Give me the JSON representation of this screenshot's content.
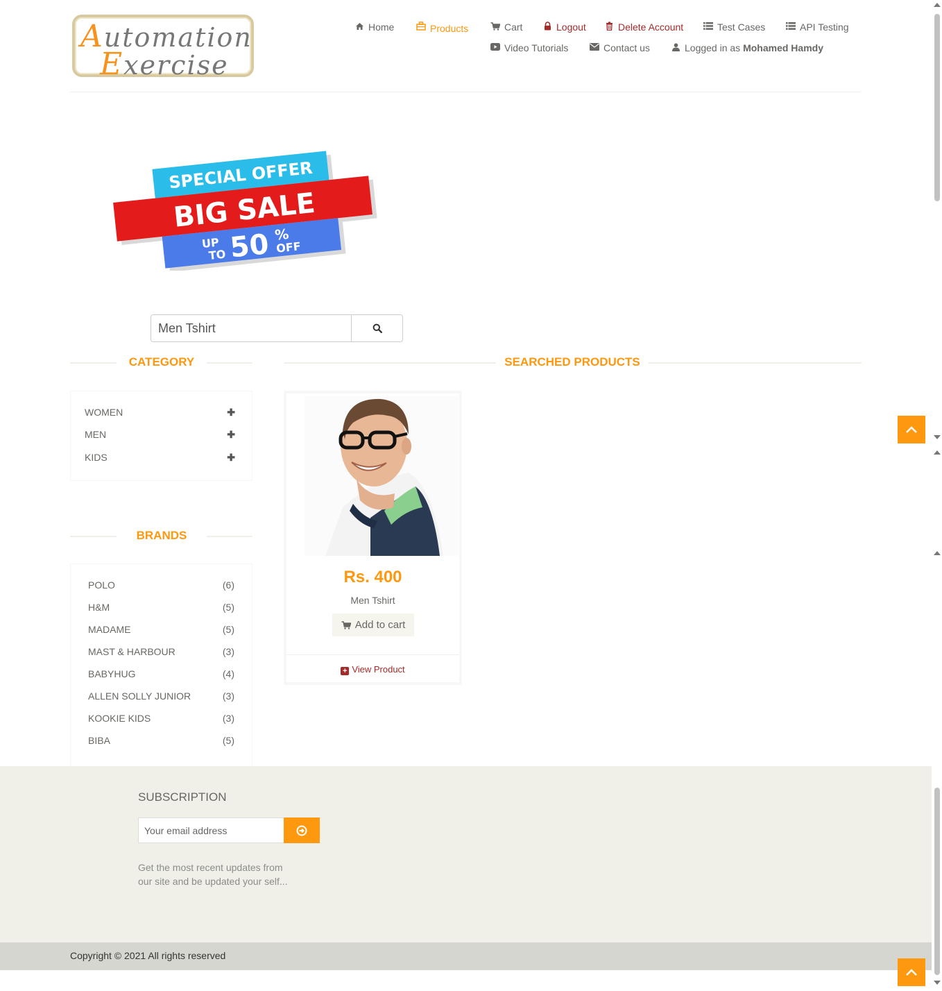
{
  "logo": {
    "line1_cap": "A",
    "line1_rest": "utomation",
    "line2_cap": "E",
    "line2_rest": "xercise"
  },
  "nav": {
    "home": "Home",
    "products": "Products",
    "cart": "Cart",
    "logout": "Logout",
    "delete_account": "Delete Account",
    "test_cases": "Test Cases",
    "api_testing": "API Testing",
    "video_tutorials": "Video Tutorials",
    "contact_us": "Contact us",
    "logged_in_prefix": "Logged in as",
    "logged_in_user": "Mohamed Hamdy"
  },
  "banner": {
    "line1": "SPECIAL OFFER",
    "line2": "BIG SALE",
    "up": "UP",
    "to": "TO",
    "amount": "50",
    "percent": "%",
    "off": "OFF"
  },
  "search": {
    "value": "Men Tshirt"
  },
  "category": {
    "title": "CATEGORY",
    "items": [
      {
        "label": "WOMEN"
      },
      {
        "label": "MEN"
      },
      {
        "label": "KIDS"
      }
    ]
  },
  "brands": {
    "title": "BRANDS",
    "items": [
      {
        "label": "POLO",
        "count": "(6)"
      },
      {
        "label": "H&M",
        "count": "(5)"
      },
      {
        "label": "MADAME",
        "count": "(5)"
      },
      {
        "label": "MAST & HARBOUR",
        "count": "(3)"
      },
      {
        "label": "BABYHUG",
        "count": "(4)"
      },
      {
        "label": "ALLEN SOLLY JUNIOR",
        "count": "(3)"
      },
      {
        "label": "KOOKIE KIDS",
        "count": "(3)"
      },
      {
        "label": "BIBA",
        "count": "(5)"
      }
    ]
  },
  "results": {
    "title": "SEARCHED PRODUCTS",
    "products": [
      {
        "price": "Rs. 400",
        "name": "Men Tshirt",
        "add_to_cart": "Add to cart",
        "view": "View Product"
      }
    ]
  },
  "footer": {
    "subscription_title": "SUBSCRIPTION",
    "email_placeholder": "Your email address",
    "text": "Get the most recent updates from our site and be updated your self...",
    "copyright": "Copyright © 2021 All rights reserved"
  },
  "colors": {
    "accent": "#fe980f",
    "link_red": "#a52a2a",
    "footer_bg": "#f0f0e9"
  }
}
